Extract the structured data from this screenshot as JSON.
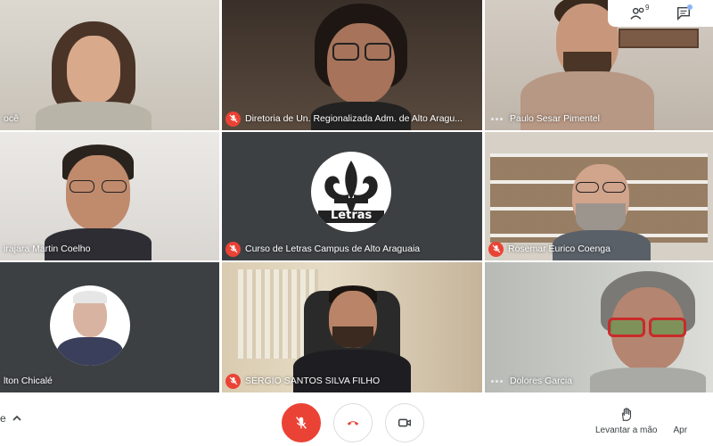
{
  "participants": [
    {
      "name": "ocê",
      "mic": "none",
      "bg": "#d9d4cb"
    },
    {
      "name": "Diretoria de Un. Regionalizada Adm. de Alto Aragu...",
      "mic": "muted",
      "bg": "#4a3b32"
    },
    {
      "name": "Paulo Sesar Pimentel",
      "mic": "speaking",
      "bg": "#cfc7be"
    },
    {
      "name": "irajara Martin Coelho",
      "mic": "none",
      "bg": "#e4e2df"
    },
    {
      "name": "Curso de Letras Campus de Alto Araguaia",
      "mic": "muted",
      "bg": "#3c4043",
      "avatar_text": "Letras"
    },
    {
      "name": "Rosemar Eurico Coenga",
      "mic": "muted",
      "bg": "#b8ad9c"
    },
    {
      "name": "lton Chicalé",
      "mic": "none",
      "bg": "#3c4043"
    },
    {
      "name": "SÉRGIO SANTOS SILVA FILHO",
      "mic": "muted",
      "bg": "#bfae8e"
    },
    {
      "name": "Dolores Garcia",
      "mic": "speaking",
      "bg": "#c9cbc6"
    }
  ],
  "top_icons": [
    {
      "icon": "people-icon",
      "badge": "9"
    },
    {
      "icon": "chat-icon",
      "badge": ""
    }
  ],
  "bottom": {
    "left_fragment": "e",
    "left_chevron": "chevron-up-icon",
    "controls": [
      {
        "icon": "mic-off-icon",
        "style": "red"
      },
      {
        "icon": "hangup-icon",
        "style": "white"
      },
      {
        "icon": "camera-icon",
        "style": "white"
      }
    ],
    "raise_hand_label": "Levantar a mão",
    "present_label": "Apr"
  },
  "colors": {
    "mute": "#ea4335",
    "tile_dark": "#3c4043",
    "text": "#3c4043"
  }
}
